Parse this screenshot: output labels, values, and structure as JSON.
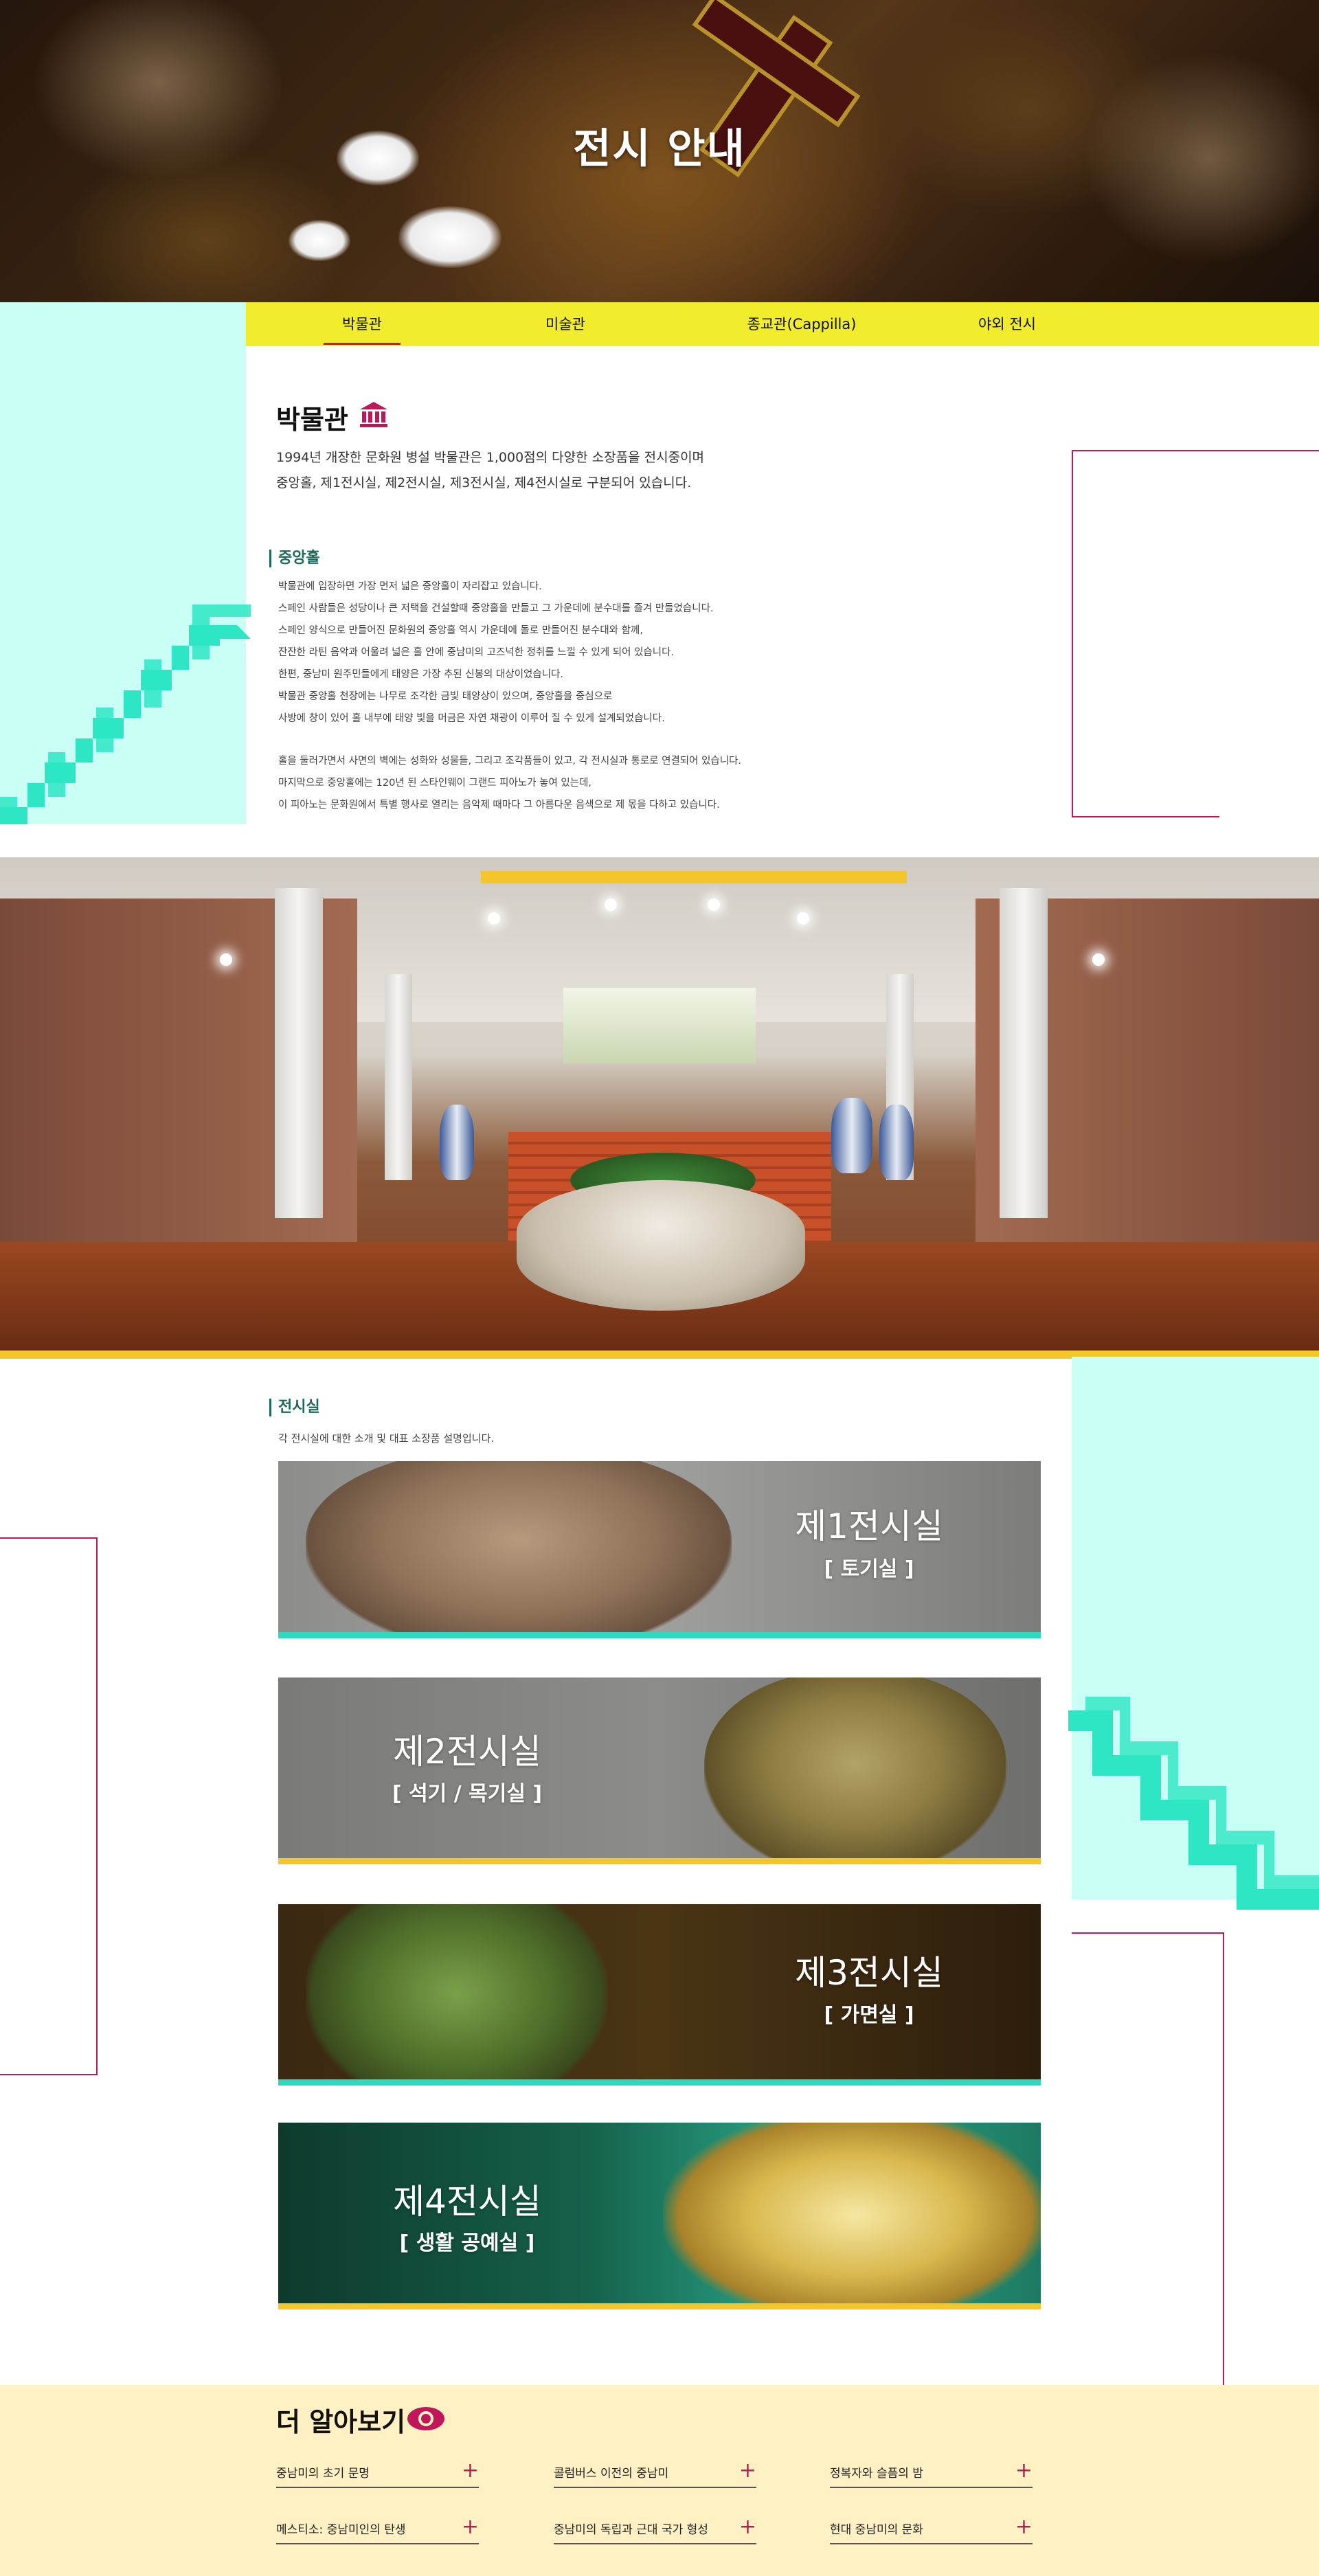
{
  "hero": {
    "title": "전시 안내"
  },
  "tabs": [
    {
      "label": "박물관",
      "active": true
    },
    {
      "label": "미술관",
      "active": false
    },
    {
      "label": "종교관(Cappilla)",
      "active": false
    },
    {
      "label": "야외 전시",
      "active": false
    }
  ],
  "museum": {
    "title": "박물관",
    "title_icon": "museum-building-icon",
    "intro": [
      "1994년 개장한 문화원 병설 박물관은 1,000점의 다양한 소장품을 전시중이며",
      "중앙홀, 제1전시실, 제2전시실, 제3전시실, 제4전시실로 구분되어 있습니다."
    ]
  },
  "central_hall": {
    "heading": "중앙홀",
    "paragraph1": [
      "박물관에 입장하면 가장 먼저 넓은 중앙홀이 자리잡고 있습니다.",
      "스페인 사람들은 성당이나 큰 저택을 건설할때 중앙홀을 만들고 그 가운데에 분수대를 즐겨 만들었습니다.",
      "스페인 양식으로 만들어진 문화원의 중앙홀 역시 가운데에 돌로 만들어진 분수대와 함께,",
      "잔잔한 라틴 음악과 어울려 넓은 홀 안에 중남미의 고즈넉한 정취를 느낄 수 있게 되어 있습니다.",
      "한편, 중남미 원주민들에게 태양은 가장 추된 신봉의 대상이었습니다.",
      "박물관 중앙홀 천장에는 나무로 조각한 금빛 태양상이 있으며, 중앙홀을 중심으로",
      "사방에 창이 있어 홀 내부에 태양 빛을 머금은 자연 채광이 이루어 질 수 있게 설계되었습니다."
    ],
    "paragraph2": [
      "홀을 둘러가면서 사면의 벽에는 성화와 성물들, 그리고 조각품들이 있고, 각 전시실과 통로로 연결되어 있습니다.",
      "마지막으로 중앙홀에는 120년 된 스타인웨이 그랜드 피아노가 놓여 있는데,",
      "이 피아노는 문화원에서 특별 행사로 열리는 음악제 때마다 그 아름다운 음색으로 제 몫을 다하고 있습니다."
    ]
  },
  "rooms_section": {
    "heading": "전시실",
    "description": "각 전시실에 대한 소개 및 대표 소장품 설명입니다.",
    "rooms": [
      {
        "name": "제1전시실",
        "tag": "[ 토기실 ]",
        "bar_color": "#2fd9c0"
      },
      {
        "name": "제2전시실",
        "tag": "[ 석기 / 목기실 ]",
        "bar_color": "#f3c62a"
      },
      {
        "name": "제3전시실",
        "tag": "[ 가면실 ]",
        "bar_color": "#2fd9c0"
      },
      {
        "name": "제4전시실",
        "tag": "[ 생활 공예실 ]",
        "bar_color": "#f3c62a"
      }
    ]
  },
  "learn_more": {
    "title": "더 알아보기",
    "icon": "eye-icon",
    "links": [
      {
        "label": "중남미의 초기 문명"
      },
      {
        "label": "콜럼버스 이전의 중남미"
      },
      {
        "label": "정복자와 슬픔의 밤"
      },
      {
        "label": "메스티소: 중남미인의 탄생"
      },
      {
        "label": "중남미의 독립과 근대 국가 형성"
      },
      {
        "label": "현대 중남미의 문화"
      }
    ]
  },
  "colors": {
    "tab_bar": "#f1ec2c",
    "accent": "#c0175a",
    "mint": "#c9fff4",
    "stair": "#2de6c4",
    "heading_green": "#1d6a5c",
    "learn_bg": "#fff1c4"
  }
}
